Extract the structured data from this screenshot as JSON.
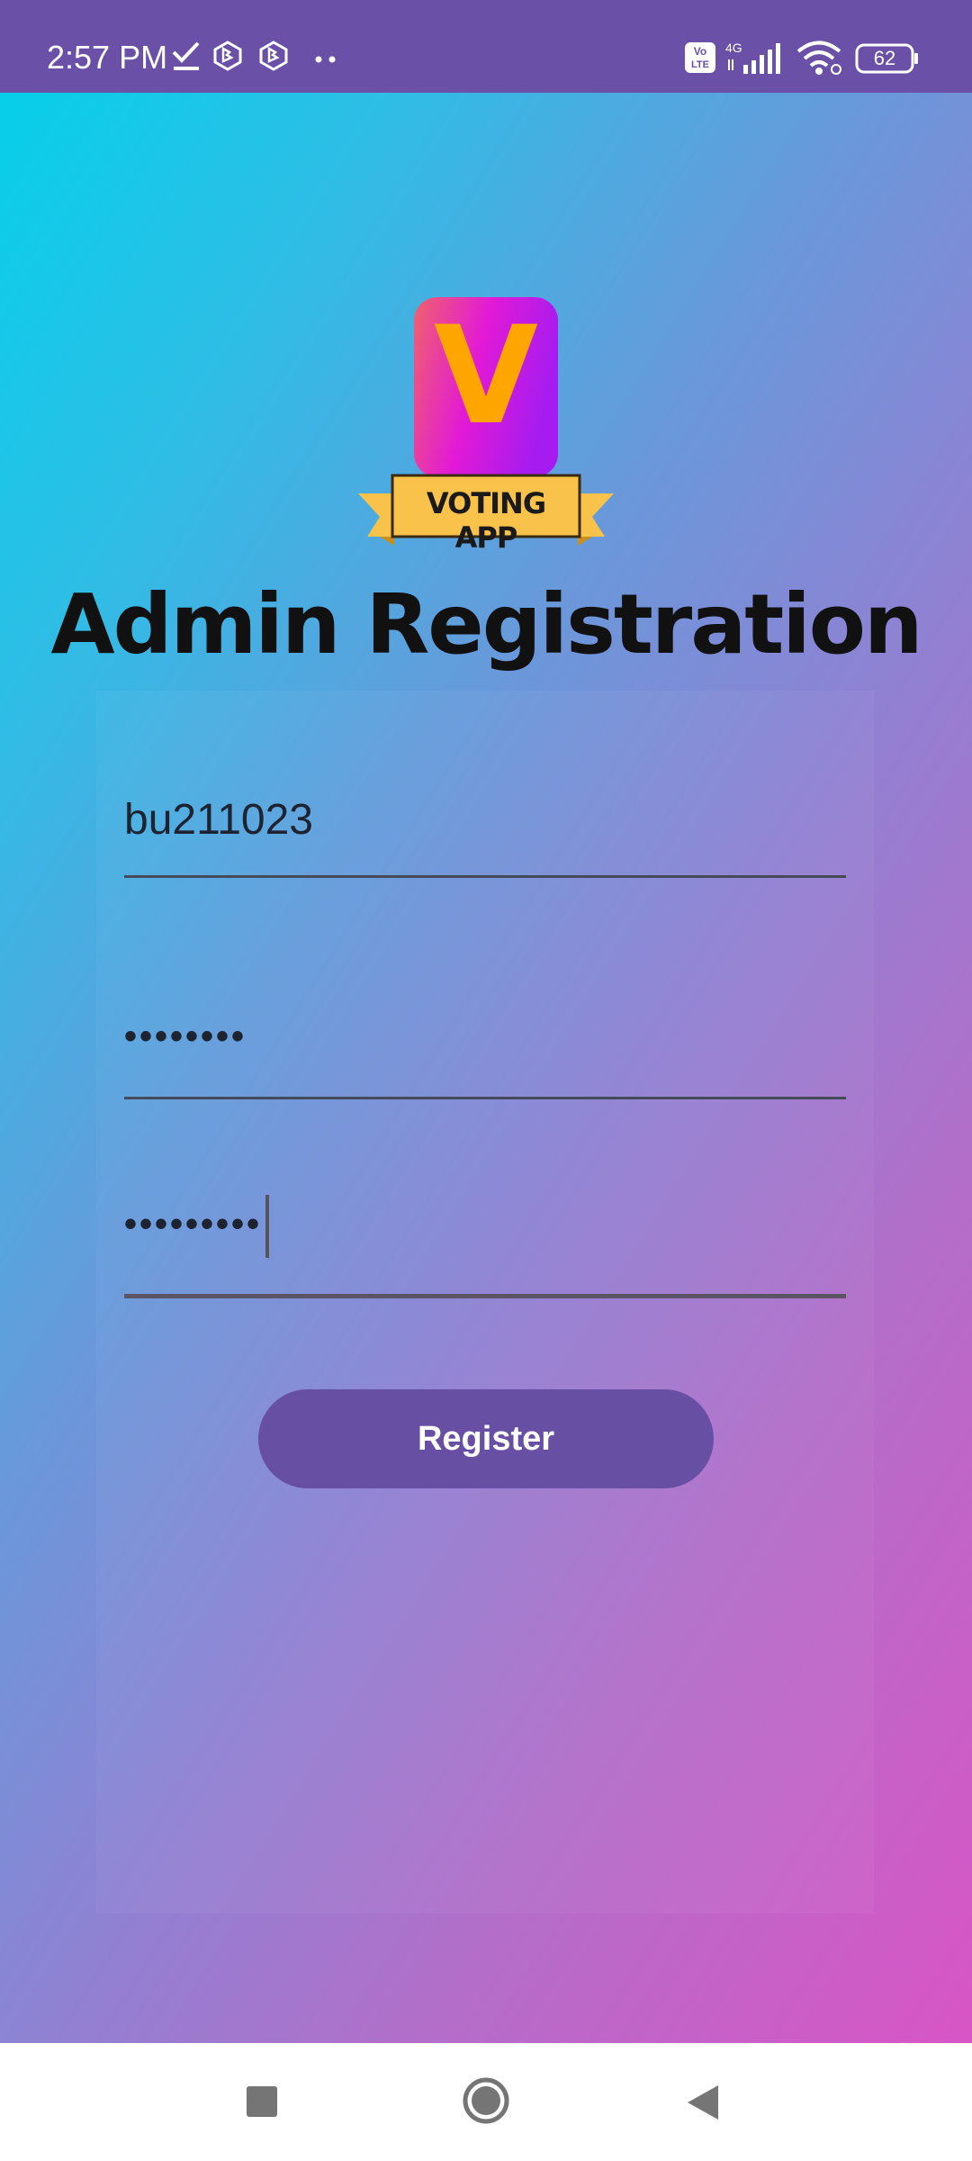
{
  "status_bar": {
    "time": "2:57 PM",
    "battery": "62",
    "network": "4G",
    "volte": "Vo LTE",
    "left_icons": [
      "check-icon",
      "bing-icon",
      "bing-icon",
      "more-dots-icon"
    ],
    "right_icons": [
      "volte-icon",
      "signal-icon",
      "wifi-icon",
      "battery-icon"
    ]
  },
  "app": {
    "logo_letter": "V",
    "logo_banner": "VOTING APP",
    "title": "Admin Registration"
  },
  "form": {
    "username_value": "bu211023",
    "password_value": "••••••••",
    "confirm_password_value": "•••••••••",
    "register_label": "Register"
  },
  "nav": {
    "buttons": [
      "recents-square-icon",
      "home-circle-icon",
      "back-triangle-icon"
    ]
  },
  "colors": {
    "status_bar": "#6a50a7",
    "button": "#6750a4",
    "gradient_start": "#07cfe9",
    "gradient_end": "#d855c6",
    "logo_orange": "#ffa500",
    "banner_yellow": "#f9c24a"
  }
}
